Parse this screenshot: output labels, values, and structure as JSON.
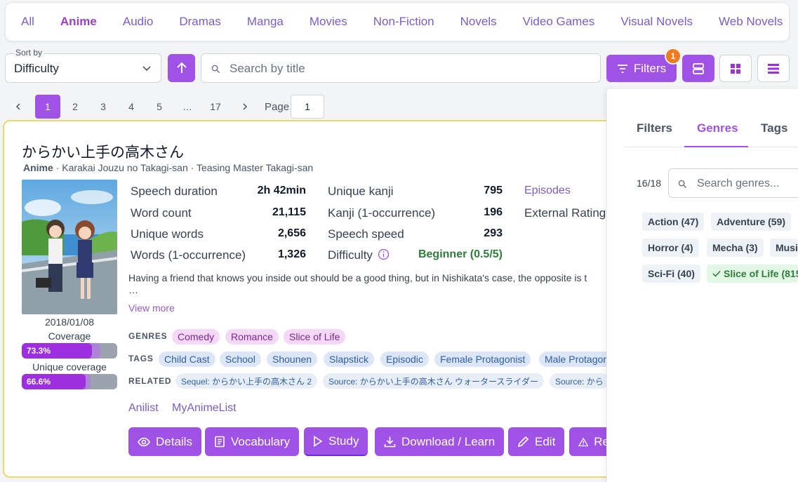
{
  "media_tabs": [
    {
      "label": "All",
      "active": false
    },
    {
      "label": "Anime",
      "active": true
    },
    {
      "label": "Audio",
      "active": false
    },
    {
      "label": "Dramas",
      "active": false
    },
    {
      "label": "Manga",
      "active": false
    },
    {
      "label": "Movies",
      "active": false
    },
    {
      "label": "Non-Fiction",
      "active": false
    },
    {
      "label": "Novels",
      "active": false
    },
    {
      "label": "Video Games",
      "active": false
    },
    {
      "label": "Visual Novels",
      "active": false
    },
    {
      "label": "Web Novels",
      "active": false
    }
  ],
  "toolbar": {
    "sort_label": "Sort by",
    "sort_value": "Difficulty",
    "search_placeholder": "Search by title",
    "filters_label": "Filters",
    "filters_badge": "1"
  },
  "pagination": {
    "pages": [
      "1",
      "2",
      "3",
      "4",
      "5",
      "…",
      "17"
    ],
    "current": "1",
    "page_label": "Page",
    "page_input": "1"
  },
  "card": {
    "title": "からかい上手の高木さん",
    "type": "Anime",
    "alt_titles": "· Karakai Jouzu no Takagi-san · Teasing Master Takagi-san",
    "date": "2018/01/08",
    "coverage_label": "Coverage",
    "coverage_value": "73.3%",
    "coverage_fraction": 0.733,
    "unique_coverage_label": "Unique coverage",
    "unique_coverage_value": "66.6%",
    "unique_coverage_fraction": 0.666,
    "stats_col1": [
      {
        "label": "Speech duration",
        "value": "2h 42min"
      },
      {
        "label": "Word count",
        "value": "21,115"
      },
      {
        "label": "Unique words",
        "value": "2,656"
      },
      {
        "label": "Words (1-occurrence)",
        "value": "1,326"
      }
    ],
    "stats_col2": [
      {
        "label": "Unique kanji",
        "value": "795"
      },
      {
        "label": "Kanji (1-occurrence)",
        "value": "196"
      },
      {
        "label": "Speech speed",
        "value": "293"
      },
      {
        "label": "Difficulty",
        "value": "Beginner (0.5/5)"
      }
    ],
    "episodes_link": "Episodes",
    "external_rating_label": "External Rating",
    "description": "Having a friend that knows you inside out should be a good thing, but in Nishikata's case, the opposite is t",
    "ellipsis": "…",
    "view_more": "View more",
    "genres_label": "GENRES",
    "genres": [
      "Comedy",
      "Romance",
      "Slice of Life"
    ],
    "tags_label": "TAGS",
    "tags": [
      "Child Cast",
      "School",
      "Shounen",
      "Slapstick",
      "Episodic",
      "Female Protagonist",
      "Male Protagon"
    ],
    "related_label": "RELATED",
    "related": [
      "Sequel: からかい上手の高木さん 2",
      "Source: からかい上手の高木さん ウォータースライダー",
      "Source: から"
    ],
    "links": [
      "Anilist",
      "MyAnimeList"
    ],
    "actions": [
      "Details",
      "Vocabulary",
      "Study",
      "Download / Learn",
      "Edit",
      "Re"
    ]
  },
  "panel": {
    "tabs": [
      "Filters",
      "Genres",
      "Tags"
    ],
    "active_tab": "Genres",
    "count": "16/18",
    "search_placeholder": "Search genres...",
    "genres": [
      {
        "label": "Action (47)",
        "selected": false
      },
      {
        "label": "Adventure (59)",
        "selected": false
      },
      {
        "label": "Horror (4)",
        "selected": false
      },
      {
        "label": "Mecha (3)",
        "selected": false
      },
      {
        "label": "Musi",
        "selected": false
      },
      {
        "label": "Sci-Fi (40)",
        "selected": false
      },
      {
        "label": "Slice of Life (815",
        "selected": true
      }
    ]
  },
  "colors": {
    "accent": "#a152e6",
    "badge": "#f07b1f",
    "difficulty": "#2f7d3a",
    "card_border": "#ecd96a"
  }
}
